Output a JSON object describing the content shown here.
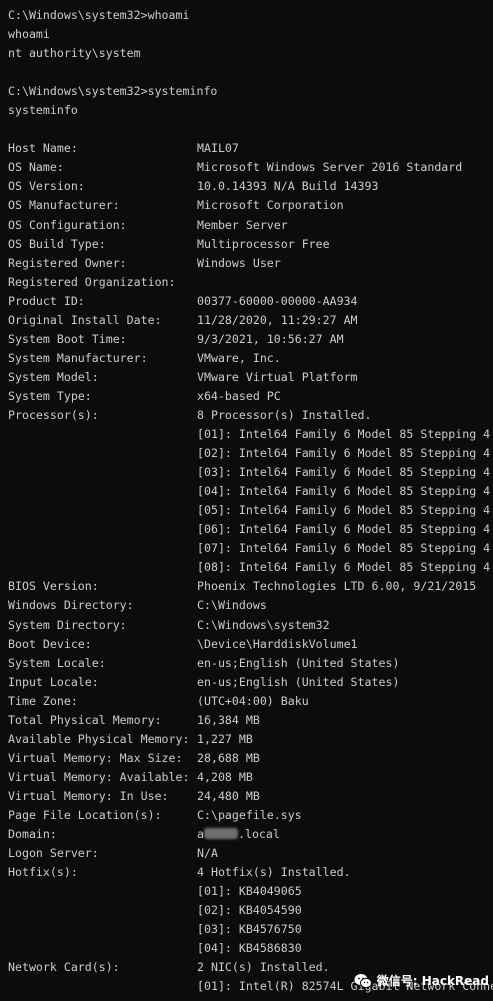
{
  "console": {
    "lines": [
      {
        "text": "C:\\Windows\\system32>whoami"
      },
      {
        "text": "whoami"
      },
      {
        "text": "nt authority\\system"
      },
      {
        "text": ""
      },
      {
        "text": "C:\\Windows\\system32>systeminfo"
      },
      {
        "text": "systeminfo"
      },
      {
        "text": ""
      },
      {
        "label": "Host Name:",
        "value": "MAIL07"
      },
      {
        "label": "OS Name:",
        "value": "Microsoft Windows Server 2016 Standard"
      },
      {
        "label": "OS Version:",
        "value": "10.0.14393 N/A Build 14393"
      },
      {
        "label": "OS Manufacturer:",
        "value": "Microsoft Corporation"
      },
      {
        "label": "OS Configuration:",
        "value": "Member Server"
      },
      {
        "label": "OS Build Type:",
        "value": "Multiprocessor Free"
      },
      {
        "label": "Registered Owner:",
        "value": "Windows User"
      },
      {
        "label": "Registered Organization:",
        "value": ""
      },
      {
        "label": "Product ID:",
        "value": "00377-60000-00000-AA934"
      },
      {
        "label": "Original Install Date:",
        "value": "11/28/2020, 11:29:27 AM"
      },
      {
        "label": "System Boot Time:",
        "value": "9/3/2021, 10:56:27 AM"
      },
      {
        "label": "System Manufacturer:",
        "value": "VMware, Inc."
      },
      {
        "label": "System Model:",
        "value": "VMware Virtual Platform"
      },
      {
        "label": "System Type:",
        "value": "x64-based PC"
      },
      {
        "label": "Processor(s):",
        "value": "8 Processor(s) Installed."
      },
      {
        "label": "",
        "value": "[01]: Intel64 Family 6 Model 85 Stepping 4"
      },
      {
        "label": "",
        "value": "[02]: Intel64 Family 6 Model 85 Stepping 4"
      },
      {
        "label": "",
        "value": "[03]: Intel64 Family 6 Model 85 Stepping 4"
      },
      {
        "label": "",
        "value": "[04]: Intel64 Family 6 Model 85 Stepping 4"
      },
      {
        "label": "",
        "value": "[05]: Intel64 Family 6 Model 85 Stepping 4"
      },
      {
        "label": "",
        "value": "[06]: Intel64 Family 6 Model 85 Stepping 4"
      },
      {
        "label": "",
        "value": "[07]: Intel64 Family 6 Model 85 Stepping 4"
      },
      {
        "label": "",
        "value": "[08]: Intel64 Family 6 Model 85 Stepping 4"
      },
      {
        "label": "BIOS Version:",
        "value": "Phoenix Technologies LTD 6.00, 9/21/2015"
      },
      {
        "label": "Windows Directory:",
        "value": "C:\\Windows"
      },
      {
        "label": "System Directory:",
        "value": "C:\\Windows\\system32"
      },
      {
        "label": "Boot Device:",
        "value": "\\Device\\HarddiskVolume1"
      },
      {
        "label": "System Locale:",
        "value": "en-us;English (United States)"
      },
      {
        "label": "Input Locale:",
        "value": "en-us;English (United States)"
      },
      {
        "label": "Time Zone:",
        "value": "(UTC+04:00) Baku"
      },
      {
        "label": "Total Physical Memory:",
        "value": "16,384 MB"
      },
      {
        "label": "Available Physical Memory:",
        "value": "1,227 MB"
      },
      {
        "label": "Virtual Memory: Max Size:",
        "value": "28,688 MB"
      },
      {
        "label": "Virtual Memory: Available:",
        "value": "4,208 MB"
      },
      {
        "label": "Virtual Memory: In Use:",
        "value": "24,480 MB"
      },
      {
        "label": "Page File Location(s):",
        "value": "C:\\pagefile.sys"
      },
      {
        "label": "Domain:",
        "value_prefix": "a",
        "value_suffix": ".local",
        "redacted": true
      },
      {
        "label": "Logon Server:",
        "value": "N/A"
      },
      {
        "label": "Hotfix(s):",
        "value": "4 Hotfix(s) Installed."
      },
      {
        "label": "",
        "value": "[01]: KB4049065"
      },
      {
        "label": "",
        "value": "[02]: KB4054590"
      },
      {
        "label": "",
        "value": "[03]: KB4576750"
      },
      {
        "label": "",
        "value": "[04]: KB4586830"
      },
      {
        "label": "Network Card(s):",
        "value": "2 NIC(s) Installed."
      },
      {
        "label": "",
        "value": "[01]: Intel(R) 82574L Gigabit Network Conne"
      }
    ]
  },
  "watermark": {
    "text": "微信号: HackRead",
    "icon": "wechat-icon"
  }
}
